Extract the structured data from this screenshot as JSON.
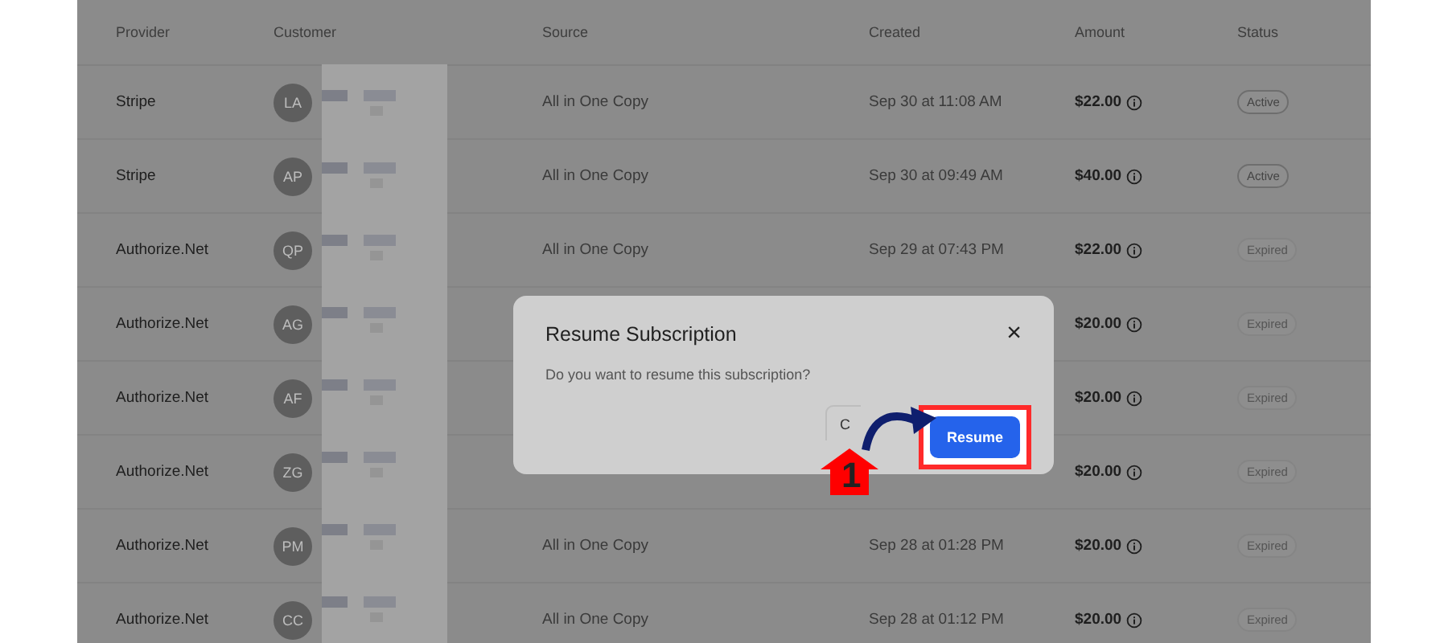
{
  "table": {
    "columns": [
      "Provider",
      "Customer",
      "Source",
      "Created",
      "Amount",
      "Status"
    ],
    "rows": [
      {
        "provider": "Stripe",
        "initials": "LA",
        "source": "All in One Copy",
        "created": "Sep 30 at 11:08 AM",
        "amount": "$22.00",
        "status": "Active"
      },
      {
        "provider": "Stripe",
        "initials": "AP",
        "source": "All in One Copy",
        "created": "Sep 30 at 09:49 AM",
        "amount": "$40.00",
        "status": "Active"
      },
      {
        "provider": "Authorize.Net",
        "initials": "QP",
        "source": "All in One Copy",
        "created": "Sep 29 at 07:43 PM",
        "amount": "$22.00",
        "status": "Expired"
      },
      {
        "provider": "Authorize.Net",
        "initials": "AG",
        "amount": "$20.00",
        "status": "Expired"
      },
      {
        "provider": "Authorize.Net",
        "initials": "AF",
        "amount": "$20.00",
        "status": "Expired"
      },
      {
        "provider": "Authorize.Net",
        "initials": "ZG",
        "amount": "$20.00",
        "status": "Expired"
      },
      {
        "provider": "Authorize.Net",
        "initials": "PM",
        "source": "All in One Copy",
        "created": "Sep 28 at 01:28 PM",
        "amount": "$20.00",
        "status": "Expired"
      },
      {
        "provider": "Authorize.Net",
        "initials": "CC",
        "source": "All in One Copy",
        "created": "Sep 28 at 01:12 PM",
        "amount": "$20.00",
        "status": "Expired"
      }
    ]
  },
  "dialog": {
    "title": "Resume Subscription",
    "close": "×",
    "message": "Do you want to resume this subscription?",
    "cancel": "C",
    "confirm": "Resume"
  },
  "annotation": {
    "step": "1"
  }
}
